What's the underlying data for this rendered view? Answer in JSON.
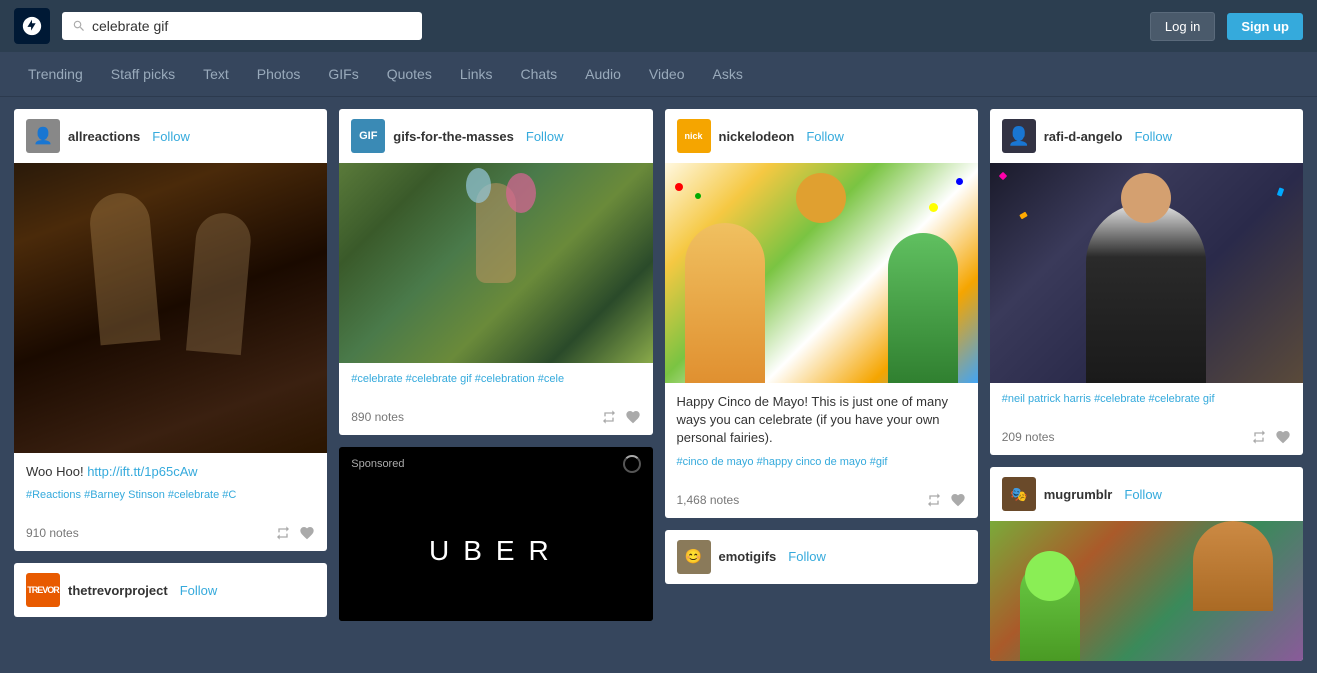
{
  "header": {
    "search_placeholder": "celebrate gif",
    "search_value": "celebrate gif",
    "login_label": "Log in",
    "signup_label": "Sign up"
  },
  "nav": {
    "items": [
      {
        "label": "Trending",
        "name": "trending"
      },
      {
        "label": "Staff picks",
        "name": "staff-picks"
      },
      {
        "label": "Text",
        "name": "text"
      },
      {
        "label": "Photos",
        "name": "photos"
      },
      {
        "label": "GIFs",
        "name": "gifs"
      },
      {
        "label": "Quotes",
        "name": "quotes"
      },
      {
        "label": "Links",
        "name": "links"
      },
      {
        "label": "Chats",
        "name": "chats"
      },
      {
        "label": "Audio",
        "name": "audio"
      },
      {
        "label": "Video",
        "name": "video"
      },
      {
        "label": "Asks",
        "name": "asks"
      }
    ]
  },
  "cards": {
    "col1": {
      "post1": {
        "username": "allreactions",
        "follow": "Follow",
        "text": "Woo Hoo!",
        "link_text": "http://ift.tt/1p65cAw",
        "tags": "#Reactions  #Barney Stinson  #celebrate  #C",
        "notes": "910 notes"
      },
      "post2": {
        "username": "thetrevorproject",
        "follow": "Follow"
      }
    },
    "col2": {
      "post1": {
        "username": "gifs-for-the-masses",
        "follow": "Follow",
        "tags": "#celebrate  #celebrate gif  #celebration  #cele",
        "notes": "890 notes"
      },
      "sponsored": {
        "label": "Sponsored",
        "brand": "UBER"
      }
    },
    "col3": {
      "post1": {
        "username": "nickelodeon",
        "follow": "Follow",
        "text": "Happy Cinco de Mayo! This is just one of many ways you can celebrate (if you have your own personal fairies).",
        "tags": "#cinco de mayo  #happy cinco de mayo  #gif",
        "notes": "1,468 notes"
      },
      "post2": {
        "username": "emotigifs",
        "follow": "Follow"
      }
    },
    "col4": {
      "post1": {
        "username": "rafi-d-angelo",
        "follow": "Follow",
        "tags": "#neil patrick harris  #celebrate  #celebrate gif",
        "notes": "209 notes"
      },
      "post2": {
        "username": "mugrumblr",
        "follow": "Follow"
      }
    }
  }
}
